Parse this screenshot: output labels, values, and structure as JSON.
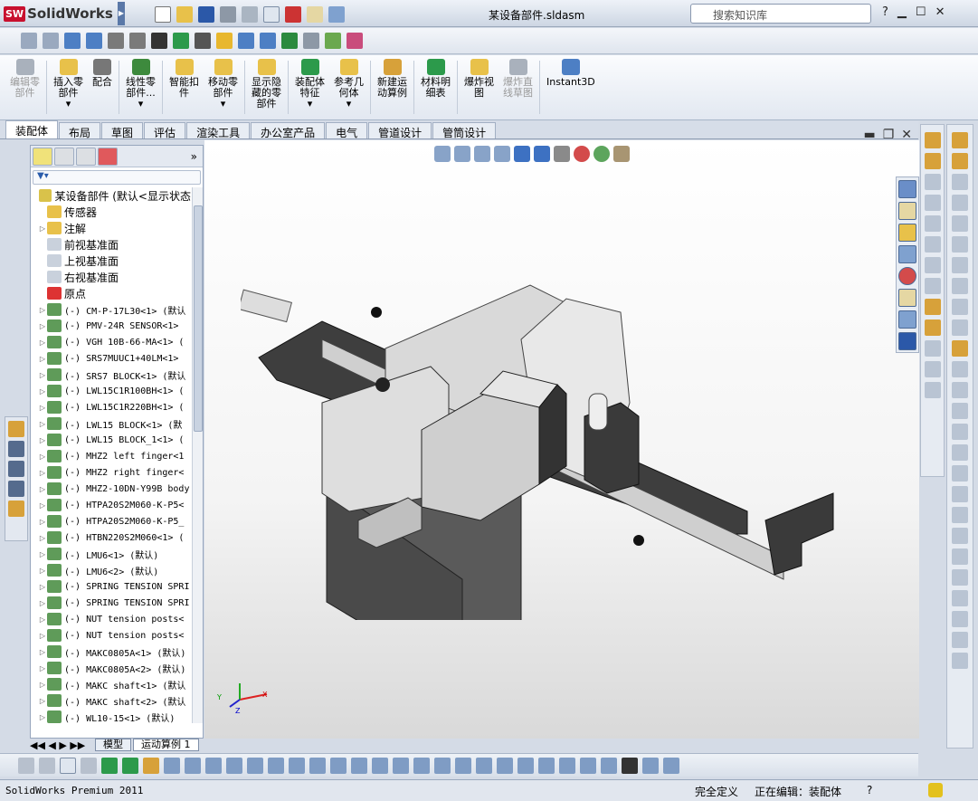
{
  "title_bar": {
    "app_name": "SolidWorks",
    "document_title": "某设备部件.sldasm",
    "search_placeholder": "搜索知识库",
    "help_label": "?"
  },
  "ribbon": {
    "buttons": [
      {
        "label": "编辑零\n部件",
        "icon": "edit-component-icon",
        "disabled": true
      },
      {
        "label": "插入零\n部件\n▾",
        "icon": "insert-component-icon"
      },
      {
        "label": "配合",
        "icon": "mate-icon"
      },
      {
        "label": "线性零\n部件...\n▾",
        "icon": "linear-pattern-icon"
      },
      {
        "label": "智能扣\n件",
        "icon": "smart-fasteners-icon"
      },
      {
        "label": "移动零\n部件\n▾",
        "icon": "move-component-icon"
      },
      {
        "label": "显示隐\n藏的零\n部件",
        "icon": "show-hidden-icon"
      },
      {
        "label": "装配体\n特征\n▾",
        "icon": "assembly-feature-icon"
      },
      {
        "label": "参考几\n何体\n▾",
        "icon": "reference-geometry-icon"
      },
      {
        "label": "新建运\n动算例",
        "icon": "new-motion-study-icon"
      },
      {
        "label": "材料明\n细表",
        "icon": "bom-icon"
      },
      {
        "label": "爆炸视\n图",
        "icon": "exploded-view-icon"
      },
      {
        "label": "爆炸直\n线草图",
        "icon": "explode-line-sketch-icon",
        "disabled": true
      },
      {
        "label": "Instant3D",
        "icon": "instant3d-icon"
      }
    ]
  },
  "command_tabs": [
    "装配体",
    "布局",
    "草图",
    "评估",
    "渲染工具",
    "办公室产品",
    "电气",
    "管道设计",
    "管筒设计"
  ],
  "active_tab": "装配体",
  "feature_tree": {
    "root": "某设备部件  (默认<显示状态",
    "items": [
      {
        "label": "传感器",
        "icon": "sensor-icon",
        "cjk": true
      },
      {
        "label": "注解",
        "icon": "annotation-icon",
        "cjk": true
      },
      {
        "label": "前视基准面",
        "icon": "plane-icon",
        "cjk": true
      },
      {
        "label": "上视基准面",
        "icon": "plane-icon",
        "cjk": true
      },
      {
        "label": "右视基准面",
        "icon": "plane-icon",
        "cjk": true
      },
      {
        "label": "原点",
        "icon": "origin-icon",
        "cjk": true
      },
      {
        "label": "(-) CM-P-17L30<1> (默认",
        "icon": "part-icon"
      },
      {
        "label": "(-) PMV-24R SENSOR<1>",
        "icon": "part-icon"
      },
      {
        "label": "(-) VGH 10B-66-MA<1>  (",
        "icon": "part-icon"
      },
      {
        "label": "(-) SRS7MUUC1+40LM<1>",
        "icon": "part-icon"
      },
      {
        "label": "(-) SRS7 BLOCK<1>  (默认",
        "icon": "part-icon"
      },
      {
        "label": "(-) LWL15C1R100BH<1> (",
        "icon": "part-icon"
      },
      {
        "label": "(-) LWL15C1R220BH<1> (",
        "icon": "part-icon"
      },
      {
        "label": "(-) LWL15 BLOCK<1>  (默",
        "icon": "part-icon"
      },
      {
        "label": "(-) LWL15 BLOCK_1<1>  (",
        "icon": "part-icon"
      },
      {
        "label": "(-) MHZ2 left finger<1",
        "icon": "part-icon"
      },
      {
        "label": "(-) MHZ2 right finger<",
        "icon": "part-icon"
      },
      {
        "label": "(-) MHZ2-10DN-Y99B body",
        "icon": "part-icon"
      },
      {
        "label": "(-) HTPA20S2M060-K-P5<",
        "icon": "part-icon"
      },
      {
        "label": "(-) HTPA20S2M060-K-P5_",
        "icon": "part-icon"
      },
      {
        "label": "(-) HTBN220S2M060<1>  (",
        "icon": "part-icon"
      },
      {
        "label": "(-) LMU6<1>  (默认)",
        "icon": "part-icon"
      },
      {
        "label": "(-) LMU6<2>  (默认)",
        "icon": "part-icon"
      },
      {
        "label": "(-) SPRING TENSION SPRI",
        "icon": "part-icon"
      },
      {
        "label": "(-) SPRING TENSION SPRI",
        "icon": "part-icon"
      },
      {
        "label": "(-) NUT tension posts<",
        "icon": "part-icon"
      },
      {
        "label": "(-) NUT tension posts<",
        "icon": "part-icon"
      },
      {
        "label": "(-) MAKC0805A<1>  (默认)",
        "icon": "part-icon"
      },
      {
        "label": "(-) MAKC0805A<2>  (默认)",
        "icon": "part-icon"
      },
      {
        "label": "(-) MAKC shaft<1>  (默认",
        "icon": "part-icon"
      },
      {
        "label": "(-) MAKC shaft<2>  (默认",
        "icon": "part-icon"
      },
      {
        "label": "(-) WL10-15<1>  (默认)",
        "icon": "part-icon"
      }
    ]
  },
  "bottom_tabs": {
    "model": "模型",
    "motion": "运动算例 1"
  },
  "triad": {
    "x": "X",
    "y": "Y",
    "z": "Z"
  },
  "status_bar": {
    "product": "SolidWorks Premium 2011",
    "state": "完全定义",
    "editing": "正在编辑：装配体",
    "help": "?"
  }
}
